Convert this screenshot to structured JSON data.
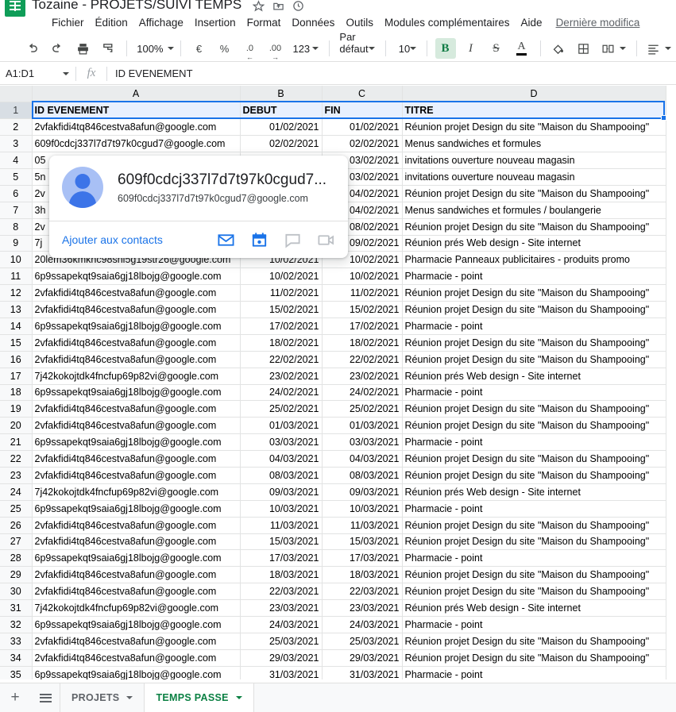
{
  "app": {
    "doc_title": "Tozaine - PROJETS/SUIVI TEMPS",
    "logo_name": "google-sheets-logo",
    "last_edit": "Dernière modifica"
  },
  "menus": [
    "Fichier",
    "Édition",
    "Affichage",
    "Insertion",
    "Format",
    "Données",
    "Outils",
    "Modules complémentaires",
    "Aide"
  ],
  "toolbar": {
    "zoom": "100%",
    "currency": "€",
    "percent": "%",
    "dec_less": ".0",
    "dec_more": ".00",
    "formats": "123",
    "font": "Par défaut ...",
    "font_size": "10",
    "bold": "B",
    "italic": "I",
    "strike": "S",
    "text_color": "A"
  },
  "formula_bar": {
    "name_box": "A1:D1",
    "fx": "fx",
    "value": "ID EVENEMENT"
  },
  "grid": {
    "columns": [
      "A",
      "B",
      "C",
      "D"
    ],
    "headers": [
      "ID EVENEMENT",
      "DEBUT",
      "FIN",
      "TITRE"
    ],
    "rows": [
      {
        "n": "2",
        "a": "2vfakfidi4tq846cestva8afun@google.com",
        "b": "01/02/2021",
        "c": "01/02/2021",
        "d": "Réunion projet Design du site \"Maison du  Shampooing\""
      },
      {
        "n": "3",
        "a": "609f0cdcj337l7d7t97k0cgud7@google.com",
        "b": "02/02/2021",
        "c": "02/02/2021",
        "d": "Menus sandwiches et formules"
      },
      {
        "n": "4",
        "a": "05",
        "b": "",
        "c": "03/02/2021",
        "d": "invitations ouverture nouveau magasin"
      },
      {
        "n": "5",
        "a": "5n",
        "b": "",
        "c": "03/02/2021",
        "d": "invitations ouverture nouveau magasin"
      },
      {
        "n": "6",
        "a": "2v",
        "b": "",
        "c": "04/02/2021",
        "d": "Réunion projet Design du site \"Maison du  Shampooing\""
      },
      {
        "n": "7",
        "a": "3h",
        "b": "",
        "c": "04/02/2021",
        "d": "Menus sandwiches et formules / boulangerie"
      },
      {
        "n": "8",
        "a": "2v",
        "b": "",
        "c": "08/02/2021",
        "d": "Réunion projet Design du site \"Maison du  Shampooing\""
      },
      {
        "n": "9",
        "a": "7j",
        "b": "",
        "c": "09/02/2021",
        "d": "Réunion prés Web design - Site internet"
      },
      {
        "n": "10",
        "a": "20lem36kmknc98snl5g19str26@google.com",
        "b": "10/02/2021",
        "c": "10/02/2021",
        "d": "Pharmacie Panneaux publicitaires - produits promo"
      },
      {
        "n": "11",
        "a": "6p9ssapekqt9saia6gj18lbojg@google.com",
        "b": "10/02/2021",
        "c": "10/02/2021",
        "d": "Pharmacie - point"
      },
      {
        "n": "12",
        "a": "2vfakfidi4tq846cestva8afun@google.com",
        "b": "11/02/2021",
        "c": "11/02/2021",
        "d": "Réunion projet Design du site \"Maison du  Shampooing\""
      },
      {
        "n": "13",
        "a": "2vfakfidi4tq846cestva8afun@google.com",
        "b": "15/02/2021",
        "c": "15/02/2021",
        "d": "Réunion projet Design du site \"Maison du  Shampooing\""
      },
      {
        "n": "14",
        "a": "6p9ssapekqt9saia6gj18lbojg@google.com",
        "b": "17/02/2021",
        "c": "17/02/2021",
        "d": "Pharmacie - point"
      },
      {
        "n": "15",
        "a": "2vfakfidi4tq846cestva8afun@google.com",
        "b": "18/02/2021",
        "c": "18/02/2021",
        "d": "Réunion projet Design du site \"Maison du  Shampooing\""
      },
      {
        "n": "16",
        "a": "2vfakfidi4tq846cestva8afun@google.com",
        "b": "22/02/2021",
        "c": "22/02/2021",
        "d": "Réunion projet Design du site \"Maison du  Shampooing\""
      },
      {
        "n": "17",
        "a": "7j42kokojtdk4fncfup69p82vi@google.com",
        "b": "23/02/2021",
        "c": "23/02/2021",
        "d": "Réunion prés Web design - Site internet"
      },
      {
        "n": "18",
        "a": "6p9ssapekqt9saia6gj18lbojg@google.com",
        "b": "24/02/2021",
        "c": "24/02/2021",
        "d": "Pharmacie - point"
      },
      {
        "n": "19",
        "a": "2vfakfidi4tq846cestva8afun@google.com",
        "b": "25/02/2021",
        "c": "25/02/2021",
        "d": "Réunion projet Design du site \"Maison du  Shampooing\""
      },
      {
        "n": "20",
        "a": "2vfakfidi4tq846cestva8afun@google.com",
        "b": "01/03/2021",
        "c": "01/03/2021",
        "d": "Réunion projet Design du site \"Maison du  Shampooing\""
      },
      {
        "n": "21",
        "a": "6p9ssapekqt9saia6gj18lbojg@google.com",
        "b": "03/03/2021",
        "c": "03/03/2021",
        "d": "Pharmacie - point"
      },
      {
        "n": "22",
        "a": "2vfakfidi4tq846cestva8afun@google.com",
        "b": "04/03/2021",
        "c": "04/03/2021",
        "d": "Réunion projet Design du site \"Maison du  Shampooing\""
      },
      {
        "n": "23",
        "a": "2vfakfidi4tq846cestva8afun@google.com",
        "b": "08/03/2021",
        "c": "08/03/2021",
        "d": "Réunion projet Design du site \"Maison du  Shampooing\""
      },
      {
        "n": "24",
        "a": "7j42kokojtdk4fncfup69p82vi@google.com",
        "b": "09/03/2021",
        "c": "09/03/2021",
        "d": "Réunion prés Web design - Site internet"
      },
      {
        "n": "25",
        "a": "6p9ssapekqt9saia6gj18lbojg@google.com",
        "b": "10/03/2021",
        "c": "10/03/2021",
        "d": "Pharmacie - point"
      },
      {
        "n": "26",
        "a": "2vfakfidi4tq846cestva8afun@google.com",
        "b": "11/03/2021",
        "c": "11/03/2021",
        "d": "Réunion projet Design du site \"Maison du  Shampooing\""
      },
      {
        "n": "27",
        "a": "2vfakfidi4tq846cestva8afun@google.com",
        "b": "15/03/2021",
        "c": "15/03/2021",
        "d": "Réunion projet Design du site \"Maison du  Shampooing\""
      },
      {
        "n": "28",
        "a": "6p9ssapekqt9saia6gj18lbojg@google.com",
        "b": "17/03/2021",
        "c": "17/03/2021",
        "d": "Pharmacie - point"
      },
      {
        "n": "29",
        "a": "2vfakfidi4tq846cestva8afun@google.com",
        "b": "18/03/2021",
        "c": "18/03/2021",
        "d": "Réunion projet Design du site \"Maison du  Shampooing\""
      },
      {
        "n": "30",
        "a": "2vfakfidi4tq846cestva8afun@google.com",
        "b": "22/03/2021",
        "c": "22/03/2021",
        "d": "Réunion projet Design du site \"Maison du  Shampooing\""
      },
      {
        "n": "31",
        "a": "7j42kokojtdk4fncfup69p82vi@google.com",
        "b": "23/03/2021",
        "c": "23/03/2021",
        "d": "Réunion prés Web design - Site internet"
      },
      {
        "n": "32",
        "a": "6p9ssapekqt9saia6gj18lbojg@google.com",
        "b": "24/03/2021",
        "c": "24/03/2021",
        "d": "Pharmacie - point"
      },
      {
        "n": "33",
        "a": "2vfakfidi4tq846cestva8afun@google.com",
        "b": "25/03/2021",
        "c": "25/03/2021",
        "d": "Réunion projet Design du site \"Maison du  Shampooing\""
      },
      {
        "n": "34",
        "a": "2vfakfidi4tq846cestva8afun@google.com",
        "b": "29/03/2021",
        "c": "29/03/2021",
        "d": "Réunion projet Design du site \"Maison du  Shampooing\""
      },
      {
        "n": "35",
        "a": "6p9ssapekqt9saia6gj18lbojg@google.com",
        "b": "31/03/2021",
        "c": "31/03/2021",
        "d": "Pharmacie - point"
      }
    ]
  },
  "contact_card": {
    "name": "609f0cdcj337l7d7t97k0cgud7...",
    "email": "609f0cdcj337l7d7t97k0cgud7@google.com",
    "add_link": "Ajouter aux contacts",
    "actions": [
      "email-icon",
      "calendar-icon",
      "chat-icon",
      "video-call-icon"
    ]
  },
  "sheet_tabs": {
    "add_label": "+",
    "all_sheets_label": "all-sheets-icon",
    "tabs": [
      {
        "label": "PROJETS",
        "active": false
      },
      {
        "label": "TEMPS PASSE",
        "active": true
      }
    ]
  },
  "colors": {
    "sheets_green": "#0f9d58",
    "active_tab_green": "#0b8043",
    "selection_blue": "#1a73e8",
    "link_blue": "#1a73e8",
    "header_fill": "#e8f0fe"
  }
}
